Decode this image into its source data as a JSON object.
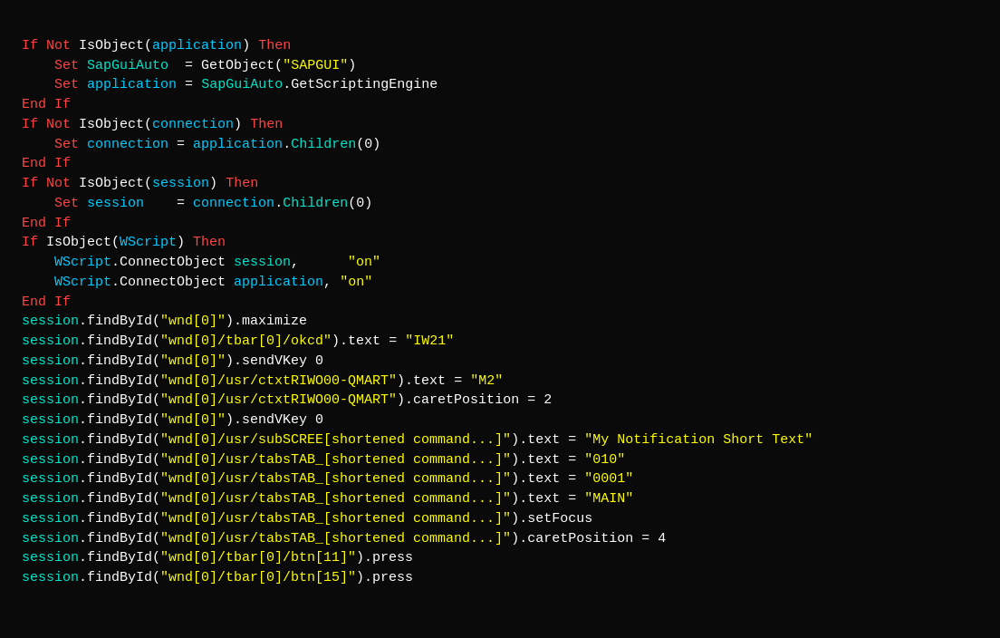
{
  "code": {
    "lines": [
      {
        "id": "l1",
        "text": "If Not IsObject(application) Then"
      },
      {
        "id": "l2",
        "text": "    Set SapGuiAuto  = GetObject(\"SAPGUI\")"
      },
      {
        "id": "l3",
        "text": "    Set application = SapGuiAuto.GetScriptingEngine"
      },
      {
        "id": "l4",
        "text": "End If"
      },
      {
        "id": "l5",
        "text": "If Not IsObject(connection) Then"
      },
      {
        "id": "l6",
        "text": "    Set connection = application.Children(0)"
      },
      {
        "id": "l7",
        "text": "End If"
      },
      {
        "id": "l8",
        "text": "If Not IsObject(session) Then"
      },
      {
        "id": "l9",
        "text": "    Set session    = connection.Children(0)"
      },
      {
        "id": "l10",
        "text": "End If"
      },
      {
        "id": "l11",
        "text": "If IsObject(WScript) Then"
      },
      {
        "id": "l12",
        "text": "    WScript.ConnectObject session,      \"on\""
      },
      {
        "id": "l13",
        "text": "    WScript.ConnectObject application, \"on\""
      },
      {
        "id": "l14",
        "text": "End If"
      },
      {
        "id": "l15",
        "text": "session.findById(\"wnd[0]\").maximize"
      },
      {
        "id": "l16",
        "text": "session.findById(\"wnd[0]/tbar[0]/okcd\").text = \"IW21\""
      },
      {
        "id": "l17",
        "text": "session.findById(\"wnd[0]\").sendVKey 0"
      },
      {
        "id": "l18",
        "text": "session.findById(\"wnd[0]/usr/ctxtRIWO00-QMART\").text = \"M2\""
      },
      {
        "id": "l19",
        "text": "session.findById(\"wnd[0]/usr/ctxtRIWO00-QMART\").caretPosition = 2"
      },
      {
        "id": "l20",
        "text": "session.findById(\"wnd[0]\").sendVKey 0"
      },
      {
        "id": "l21",
        "text": "session.findById(\"wnd[0]/usr/subSCREE[shortened command...]\").text = \"My Notification Short Text\""
      },
      {
        "id": "l22",
        "text": "session.findById(\"wnd[0]/usr/tabsTAB_[shortened command...]\").text = \"010\""
      },
      {
        "id": "l23",
        "text": "session.findById(\"wnd[0]/usr/tabsTAB_[shortened command...]\").text = \"0001\""
      },
      {
        "id": "l24",
        "text": "session.findById(\"wnd[0]/usr/tabsTAB_[shortened command...]\").text = \"MAIN\""
      },
      {
        "id": "l25",
        "text": "session.findById(\"wnd[0]/usr/tabsTAB_[shortened command...]\").setFocus"
      },
      {
        "id": "l26",
        "text": "session.findById(\"wnd[0]/usr/tabsTAB_[shortened command...]\").caretPosition = 4"
      },
      {
        "id": "l27",
        "text": "session.findById(\"wnd[0]/tbar[0]/btn[11]\").press"
      },
      {
        "id": "l28",
        "text": "session.findById(\"wnd[0]/tbar[0]/btn[15]\").press"
      }
    ]
  }
}
